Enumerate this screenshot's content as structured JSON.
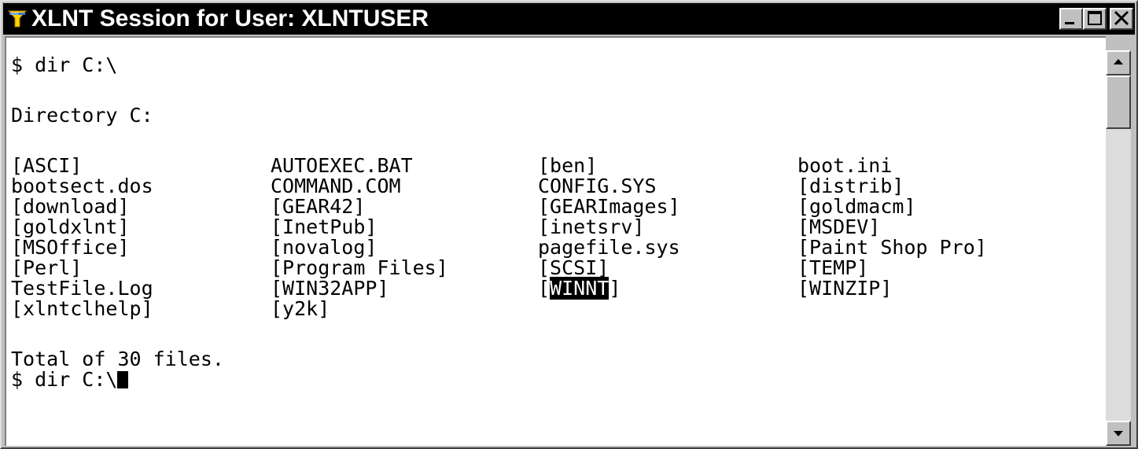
{
  "window": {
    "title": "XLNT Session for User: XLNTUSER",
    "icon": "xlnt-app-icon",
    "controls": {
      "minimize": "minimize-icon",
      "maximize": "maximize-icon",
      "close": "close-icon"
    }
  },
  "terminal": {
    "command_line_1": "$ dir C:\\",
    "directory_header": "Directory C:",
    "listing": [
      [
        "[ASCI]",
        "AUTOEXEC.BAT",
        "[ben]",
        "boot.ini"
      ],
      [
        "bootsect.dos",
        "COMMAND.COM",
        "CONFIG.SYS",
        "[distrib]"
      ],
      [
        "[download]",
        "[GEAR42]",
        "[GEARImages]",
        "[goldmacm]"
      ],
      [
        "[goldxlnt]",
        "[InetPub]",
        "[inetsrv]",
        "[MSDEV]"
      ],
      [
        "[MSOffice]",
        "[novalog]",
        "pagefile.sys",
        "[Paint Shop Pro]"
      ],
      [
        "[Perl]",
        "[Program Files]",
        "[SCSI]",
        "[TEMP]"
      ],
      [
        "TestFile.Log",
        "[WIN32APP]",
        "[WINNT]",
        "[WINZIP]"
      ],
      [
        "[xlntclhelp]",
        "[y2k]",
        "",
        ""
      ]
    ],
    "selected_entry": {
      "prefix": "[",
      "highlight": "WINNT",
      "suffix": "]"
    },
    "summary": "Total of 30 files.",
    "command_line_2": "$ dir C:\\"
  },
  "colors": {
    "titlebar": "#000000",
    "title_text": "#ffffff",
    "terminal_bg": "#ffffff",
    "terminal_text": "#000000",
    "chrome": "#c0c0c0",
    "icon_accent": "#ffd000"
  }
}
